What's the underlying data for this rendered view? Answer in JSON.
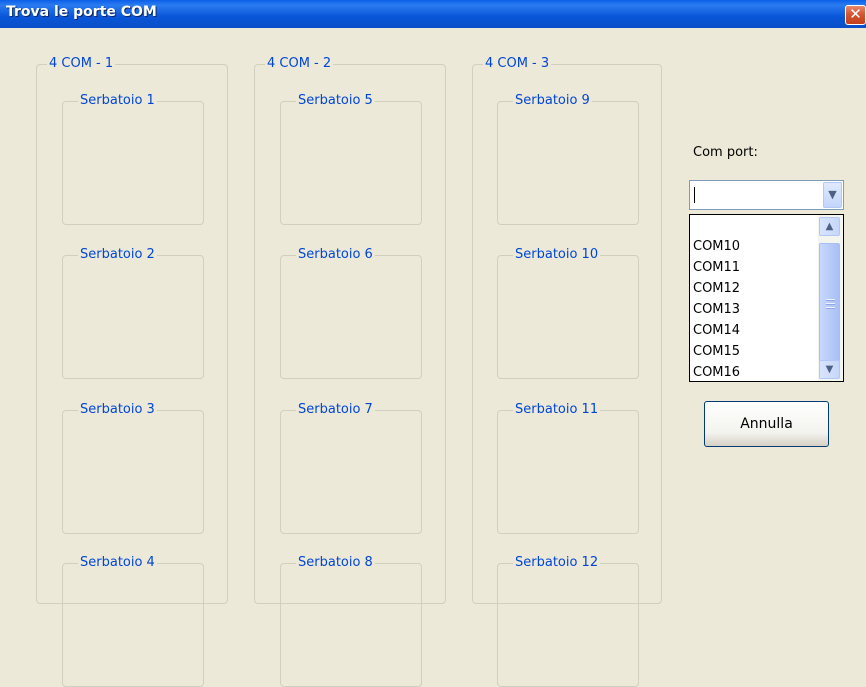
{
  "window": {
    "title": "Trova le porte COM",
    "close_glyph": "✕"
  },
  "groups": [
    {
      "label": "4 COM - 1",
      "tanks": [
        "Serbatoio 1",
        "Serbatoio 2",
        "Serbatoio 3",
        "Serbatoio 4"
      ]
    },
    {
      "label": "4 COM - 2",
      "tanks": [
        "Serbatoio 5",
        "Serbatoio 6",
        "Serbatoio 7",
        "Serbatoio 8"
      ]
    },
    {
      "label": "4 COM - 3",
      "tanks": [
        "Serbatoio 9",
        "Serbatoio 10",
        "Serbatoio 11",
        "Serbatoio 12"
      ]
    }
  ],
  "com_port": {
    "label": "Com port:",
    "value": "",
    "options": [
      "COM10",
      "COM11",
      "COM12",
      "COM13",
      "COM14",
      "COM15",
      "COM16"
    ]
  },
  "cancel_button": {
    "label": "Annulla"
  },
  "icons": {
    "close": "close-icon",
    "dropdown": "chevron-down-icon",
    "scroll_up": "scroll-up-icon",
    "scroll_down": "scroll-down-icon"
  },
  "colors": {
    "titlebar": "#0A5FE8",
    "group_label": "#0046D5",
    "window_bg": "#ECE9D8"
  }
}
